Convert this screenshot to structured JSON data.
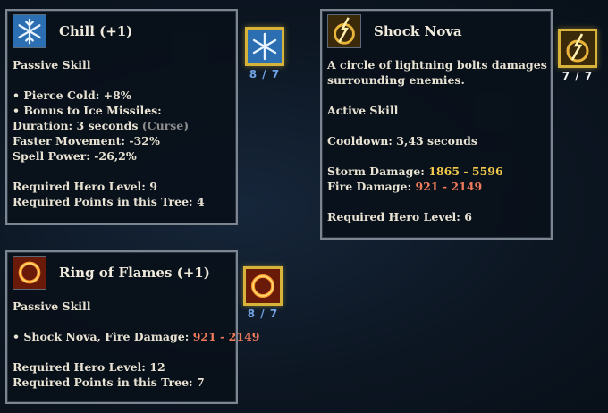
{
  "chill": {
    "title": "Chill (+1)",
    "icon": "snowflake-icon",
    "lines": [
      {
        "type": "text",
        "text": "Passive Skill"
      },
      {
        "type": "gap"
      },
      {
        "type": "text",
        "text": "• Pierce Cold: +8%"
      },
      {
        "type": "text",
        "text": "• Bonus to Ice Missiles:"
      },
      {
        "type": "dual",
        "text": "Duration: 3 seconds ",
        "value": "(Curse)",
        "color": "grey"
      },
      {
        "type": "text",
        "text": "Faster Movement: -32%"
      },
      {
        "type": "text",
        "text": "Spell Power: -26,2%"
      },
      {
        "type": "gap"
      },
      {
        "type": "text",
        "text": "Required Hero Level: 9"
      },
      {
        "type": "text",
        "text": "Required Points in this Tree: 4"
      }
    ],
    "rank": "8 / 7"
  },
  "shock_nova": {
    "title": "Shock Nova",
    "icon": "lightning-nova-icon",
    "lines": [
      {
        "type": "text",
        "text": "A circle of lightning bolts damages"
      },
      {
        "type": "text",
        "text": "surrounding enemies."
      },
      {
        "type": "gap"
      },
      {
        "type": "text",
        "text": "Active Skill"
      },
      {
        "type": "gap"
      },
      {
        "type": "text",
        "text": "Cooldown: 3,43 seconds"
      },
      {
        "type": "gap"
      },
      {
        "type": "dual",
        "text": "Storm Damage: ",
        "value": "1865 - 5596",
        "color": "gold"
      },
      {
        "type": "dual",
        "text": "Fire Damage: ",
        "value": "921 - 2149",
        "color": "red"
      },
      {
        "type": "gap"
      },
      {
        "type": "text",
        "text": "Required Hero Level: 6"
      }
    ],
    "rank": "7 / 7"
  },
  "ring_of_flames": {
    "title": "Ring of Flames (+1)",
    "icon": "fire-ring-icon",
    "lines": [
      {
        "type": "text",
        "text": "Passive Skill"
      },
      {
        "type": "gap"
      },
      {
        "type": "dual",
        "text": "• Shock Nova, Fire Damage: ",
        "value": "921 - 2149",
        "color": "red"
      },
      {
        "type": "gap"
      },
      {
        "type": "text",
        "text": "Required Hero Level: 12"
      },
      {
        "type": "text",
        "text": "Required Points in this Tree: 7"
      }
    ],
    "rank": "8 / 7"
  },
  "colors": {
    "gold": "#f2c94c",
    "red": "#f07a5a",
    "rank_blue": "#6fa3e6",
    "slot_border": "#d7b33a"
  }
}
